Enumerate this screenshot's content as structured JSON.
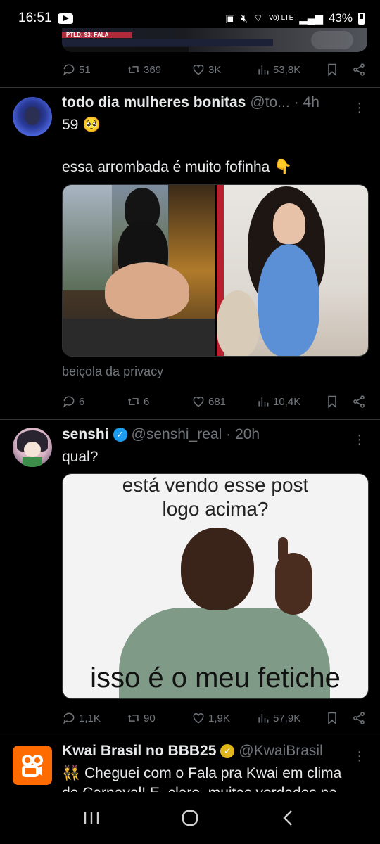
{
  "status_bar": {
    "time": "16:51",
    "network": "Vo) LTE",
    "battery": "43%"
  },
  "top_tweet": {
    "media_overlay_text": "PTLD: 93: FALA",
    "stats": {
      "replies": "51",
      "retweets": "369",
      "likes": "3K",
      "views": "53,8K"
    }
  },
  "tweets": [
    {
      "name": "todo dia mulheres bonitas",
      "handle": "@to...",
      "time": "· 4h",
      "lines": [
        "59 🥺",
        "essa arrombada é muito fofinha 👇"
      ],
      "caption": "beiçola da privacy",
      "stats": {
        "replies": "6",
        "retweets": "6",
        "likes": "681",
        "views": "10,4K"
      }
    },
    {
      "name": "senshi",
      "handle": "@senshi_real",
      "time": "· 20h",
      "lines": [
        "qual?"
      ],
      "meme_top_1": "está vendo esse post",
      "meme_top_2": "logo acima?",
      "meme_bottom": "isso é o meu fetiche",
      "stats": {
        "replies": "1,1K",
        "retweets": "90",
        "likes": "1,9K",
        "views": "57,9K"
      }
    },
    {
      "name": "Kwai Brasil no BBB25",
      "handle": "@KwaiBrasil",
      "lines": [
        "👯 Cheguei com o Fala pra Kwai em clima",
        "de Carnaval! E, claro, muitas verdades na"
      ]
    }
  ],
  "colors": {
    "background": "#000000",
    "text": "#e7e9ea",
    "muted": "#71767b",
    "divider": "#2f3336",
    "verified_blue": "#1d9bf0",
    "verified_gold": "#e2b719",
    "kwai_orange": "#ff6b00"
  },
  "icons": [
    "reply-icon",
    "retweet-icon",
    "like-icon",
    "views-icon",
    "bookmark-icon",
    "share-icon",
    "more-icon",
    "recents-icon",
    "home-icon",
    "back-icon"
  ]
}
